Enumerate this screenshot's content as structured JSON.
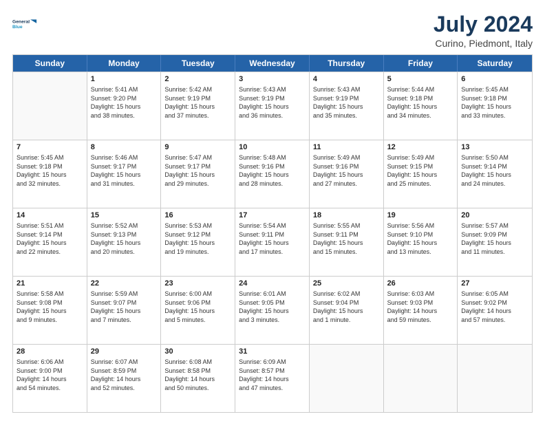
{
  "logo": {
    "line1": "General",
    "line2": "Blue"
  },
  "title": "July 2024",
  "subtitle": "Curino, Piedmont, Italy",
  "headers": [
    "Sunday",
    "Monday",
    "Tuesday",
    "Wednesday",
    "Thursday",
    "Friday",
    "Saturday"
  ],
  "rows": [
    [
      {
        "day": "",
        "info": ""
      },
      {
        "day": "1",
        "info": "Sunrise: 5:41 AM\nSunset: 9:20 PM\nDaylight: 15 hours\nand 38 minutes."
      },
      {
        "day": "2",
        "info": "Sunrise: 5:42 AM\nSunset: 9:19 PM\nDaylight: 15 hours\nand 37 minutes."
      },
      {
        "day": "3",
        "info": "Sunrise: 5:43 AM\nSunset: 9:19 PM\nDaylight: 15 hours\nand 36 minutes."
      },
      {
        "day": "4",
        "info": "Sunrise: 5:43 AM\nSunset: 9:19 PM\nDaylight: 15 hours\nand 35 minutes."
      },
      {
        "day": "5",
        "info": "Sunrise: 5:44 AM\nSunset: 9:18 PM\nDaylight: 15 hours\nand 34 minutes."
      },
      {
        "day": "6",
        "info": "Sunrise: 5:45 AM\nSunset: 9:18 PM\nDaylight: 15 hours\nand 33 minutes."
      }
    ],
    [
      {
        "day": "7",
        "info": "Sunrise: 5:45 AM\nSunset: 9:18 PM\nDaylight: 15 hours\nand 32 minutes."
      },
      {
        "day": "8",
        "info": "Sunrise: 5:46 AM\nSunset: 9:17 PM\nDaylight: 15 hours\nand 31 minutes."
      },
      {
        "day": "9",
        "info": "Sunrise: 5:47 AM\nSunset: 9:17 PM\nDaylight: 15 hours\nand 29 minutes."
      },
      {
        "day": "10",
        "info": "Sunrise: 5:48 AM\nSunset: 9:16 PM\nDaylight: 15 hours\nand 28 minutes."
      },
      {
        "day": "11",
        "info": "Sunrise: 5:49 AM\nSunset: 9:16 PM\nDaylight: 15 hours\nand 27 minutes."
      },
      {
        "day": "12",
        "info": "Sunrise: 5:49 AM\nSunset: 9:15 PM\nDaylight: 15 hours\nand 25 minutes."
      },
      {
        "day": "13",
        "info": "Sunrise: 5:50 AM\nSunset: 9:14 PM\nDaylight: 15 hours\nand 24 minutes."
      }
    ],
    [
      {
        "day": "14",
        "info": "Sunrise: 5:51 AM\nSunset: 9:14 PM\nDaylight: 15 hours\nand 22 minutes."
      },
      {
        "day": "15",
        "info": "Sunrise: 5:52 AM\nSunset: 9:13 PM\nDaylight: 15 hours\nand 20 minutes."
      },
      {
        "day": "16",
        "info": "Sunrise: 5:53 AM\nSunset: 9:12 PM\nDaylight: 15 hours\nand 19 minutes."
      },
      {
        "day": "17",
        "info": "Sunrise: 5:54 AM\nSunset: 9:11 PM\nDaylight: 15 hours\nand 17 minutes."
      },
      {
        "day": "18",
        "info": "Sunrise: 5:55 AM\nSunset: 9:11 PM\nDaylight: 15 hours\nand 15 minutes."
      },
      {
        "day": "19",
        "info": "Sunrise: 5:56 AM\nSunset: 9:10 PM\nDaylight: 15 hours\nand 13 minutes."
      },
      {
        "day": "20",
        "info": "Sunrise: 5:57 AM\nSunset: 9:09 PM\nDaylight: 15 hours\nand 11 minutes."
      }
    ],
    [
      {
        "day": "21",
        "info": "Sunrise: 5:58 AM\nSunset: 9:08 PM\nDaylight: 15 hours\nand 9 minutes."
      },
      {
        "day": "22",
        "info": "Sunrise: 5:59 AM\nSunset: 9:07 PM\nDaylight: 15 hours\nand 7 minutes."
      },
      {
        "day": "23",
        "info": "Sunrise: 6:00 AM\nSunset: 9:06 PM\nDaylight: 15 hours\nand 5 minutes."
      },
      {
        "day": "24",
        "info": "Sunrise: 6:01 AM\nSunset: 9:05 PM\nDaylight: 15 hours\nand 3 minutes."
      },
      {
        "day": "25",
        "info": "Sunrise: 6:02 AM\nSunset: 9:04 PM\nDaylight: 15 hours\nand 1 minute."
      },
      {
        "day": "26",
        "info": "Sunrise: 6:03 AM\nSunset: 9:03 PM\nDaylight: 14 hours\nand 59 minutes."
      },
      {
        "day": "27",
        "info": "Sunrise: 6:05 AM\nSunset: 9:02 PM\nDaylight: 14 hours\nand 57 minutes."
      }
    ],
    [
      {
        "day": "28",
        "info": "Sunrise: 6:06 AM\nSunset: 9:00 PM\nDaylight: 14 hours\nand 54 minutes."
      },
      {
        "day": "29",
        "info": "Sunrise: 6:07 AM\nSunset: 8:59 PM\nDaylight: 14 hours\nand 52 minutes."
      },
      {
        "day": "30",
        "info": "Sunrise: 6:08 AM\nSunset: 8:58 PM\nDaylight: 14 hours\nand 50 minutes."
      },
      {
        "day": "31",
        "info": "Sunrise: 6:09 AM\nSunset: 8:57 PM\nDaylight: 14 hours\nand 47 minutes."
      },
      {
        "day": "",
        "info": ""
      },
      {
        "day": "",
        "info": ""
      },
      {
        "day": "",
        "info": ""
      }
    ]
  ]
}
